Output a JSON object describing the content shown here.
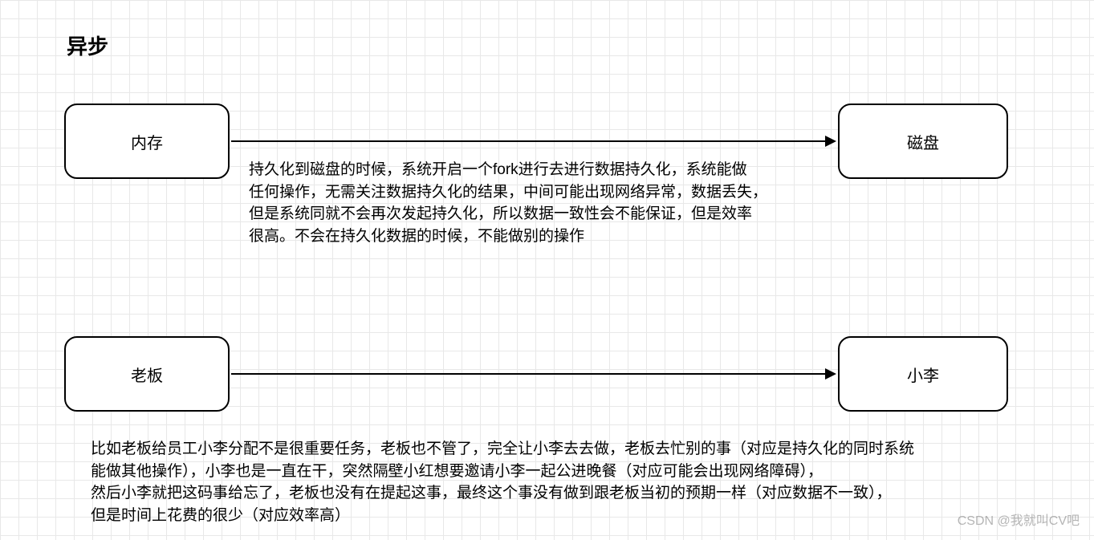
{
  "title": "异步",
  "nodes": {
    "memory": "内存",
    "disk": "磁盘",
    "boss": "老板",
    "li": "小李"
  },
  "desc1": "持久化到磁盘的时候，系统开启一个fork进行去进行数据持久化，系统能做\n任何操作，无需关注数据持久化的结果，中间可能出现网络异常，数据丢失，\n但是系统同就不会再次发起持久化，所以数据一致性会不能保证，但是效率\n很高。不会在持久化数据的时候，不能做别的操作",
  "desc2": "比如老板给员工小李分配不是很重要任务，老板也不管了，完全让小李去去做，老板去忙别的事（对应是持久化的同时系统\n能做其他操作），小李也是一直在干，突然隔壁小红想要邀请小李一起公进晚餐（对应可能会出现网络障碍），\n然后小李就把这码事给忘了，老板也没有在提起这事，最终这个事没有做到跟老板当初的预期一样（对应数据不一致），\n但是时间上花费的很少（对应效率高）",
  "watermark": "CSDN @我就叫CV吧"
}
